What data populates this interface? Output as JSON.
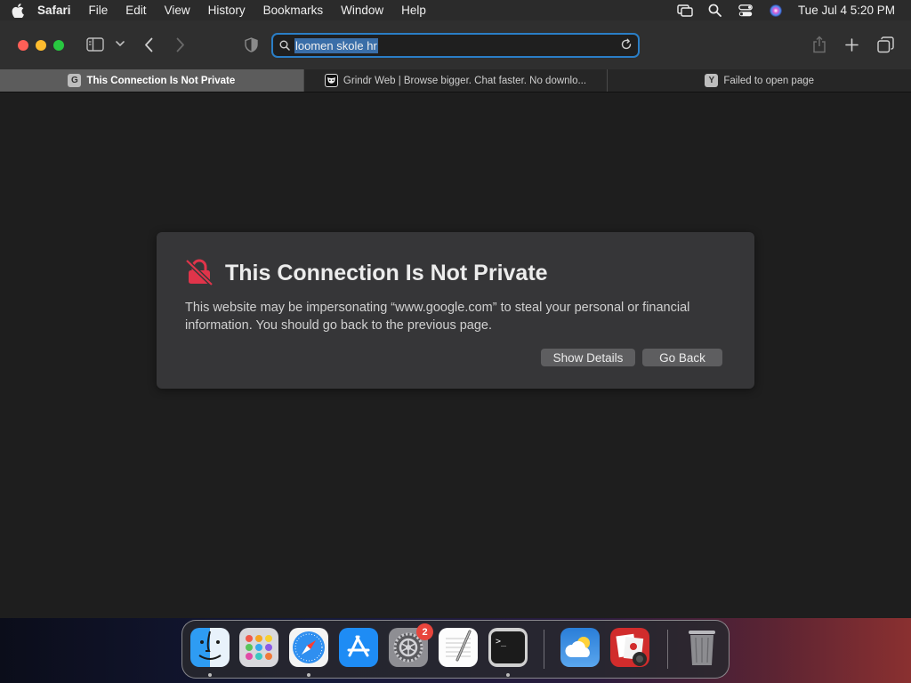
{
  "menubar": {
    "app_name": "Safari",
    "items": [
      "File",
      "Edit",
      "View",
      "History",
      "Bookmarks",
      "Window",
      "Help"
    ],
    "clock": "Tue Jul 4  5:20 PM"
  },
  "toolbar": {
    "address_value": "loomen skole hr"
  },
  "tabs": [
    {
      "favicon": "G",
      "label": "This Connection Is Not Private",
      "active": true
    },
    {
      "favicon": "grindr",
      "label": "Grindr Web | Browse bigger. Chat faster. No downlo...",
      "active": false
    },
    {
      "favicon": "Y",
      "label": "Failed to open page",
      "active": false
    }
  ],
  "error_page": {
    "title": "This Connection Is Not Private",
    "message": "This website may be impersonating “www.google.com” to steal your personal or financial information. You should go back to the previous page.",
    "show_details_label": "Show Details",
    "go_back_label": "Go Back"
  },
  "dock": {
    "apps": [
      "finder",
      "launchpad",
      "safari",
      "app-store",
      "system-settings",
      "textedit",
      "terminal",
      "weather",
      "photo-booth",
      "trash"
    ],
    "system_settings_badge": "2"
  },
  "colors": {
    "accent": "#2a7ec6",
    "warning_red": "#e0344a",
    "panel_bg": "#363638"
  }
}
